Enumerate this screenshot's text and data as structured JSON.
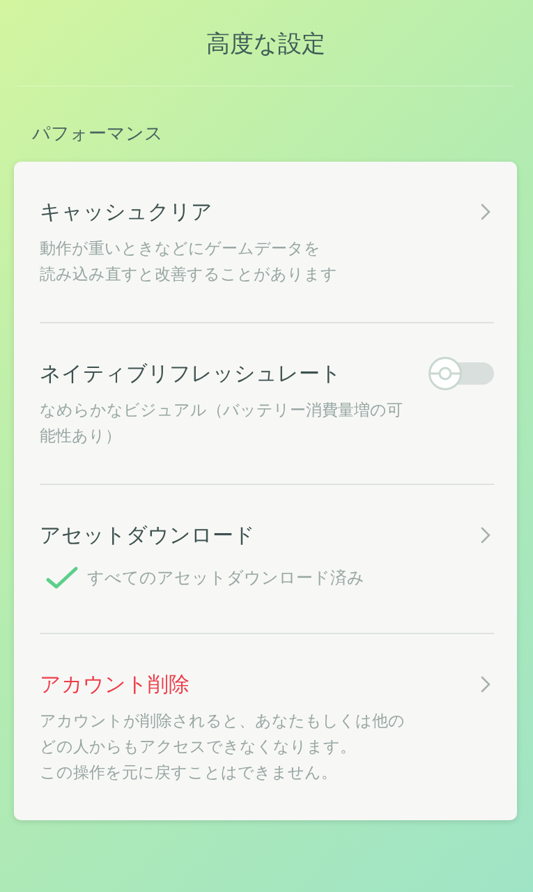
{
  "header": {
    "title": "高度な設定"
  },
  "section": {
    "label": "パフォーマンス"
  },
  "items": [
    {
      "kind": "link",
      "title": "キャッシュクリア",
      "danger": false,
      "description": [
        "動作が重いときなどにゲームデータを",
        "読み込み直すと改善することがあります"
      ]
    },
    {
      "kind": "toggle",
      "title": "ネイティブリフレッシュレート",
      "danger": false,
      "on": false,
      "description": [
        "なめらかなビジュアル（バッテリー消費量増の可",
        "能性あり）"
      ]
    },
    {
      "kind": "status",
      "title": "アセットダウンロード",
      "danger": false,
      "status": "すべてのアセットダウンロード済み"
    },
    {
      "kind": "link",
      "title": "アカウント削除",
      "danger": true,
      "description": [
        "アカウントが削除されると、あなたもしくは他の",
        "どの人からもアクセスできなくなります。",
        "この操作を元に戻すことはできません。"
      ]
    }
  ]
}
